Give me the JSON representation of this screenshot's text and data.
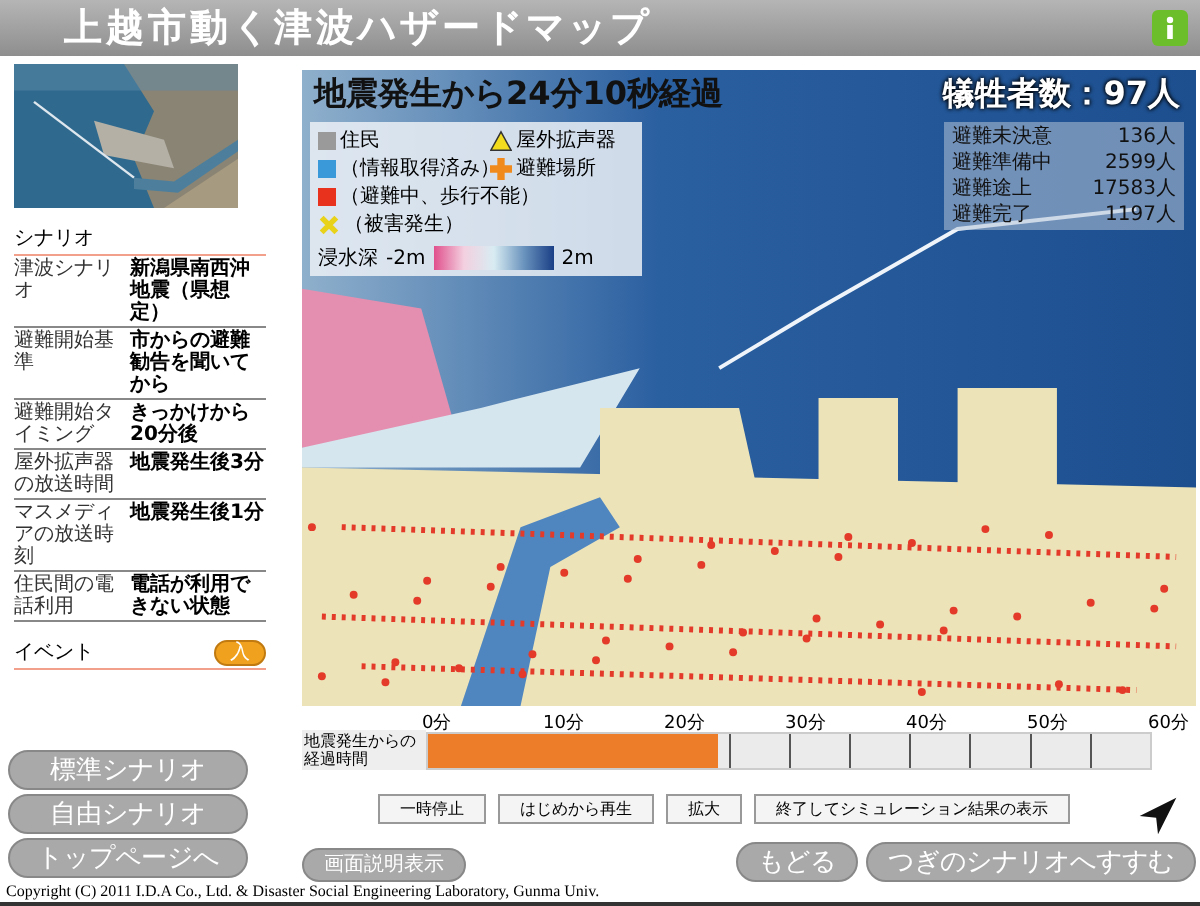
{
  "header": {
    "title": "上越市動く津波ハザードマップ"
  },
  "scenario": {
    "heading": "シナリオ",
    "rows": [
      {
        "label": "津波シナリオ",
        "value": "新潟県南西沖地震（県想定）"
      },
      {
        "label": "避難開始基準",
        "value": "市からの避難勧告を聞いてから"
      },
      {
        "label": "避難開始タイミング",
        "value": "きっかけから20分後"
      },
      {
        "label": "屋外拡声器の放送時間",
        "value": "地震発生後3分"
      },
      {
        "label": "マスメディアの放送時刻",
        "value": "地震発生後1分"
      },
      {
        "label": "住民間の電話利用",
        "value": "電話が利用できない状態"
      }
    ]
  },
  "event": {
    "heading": "イベント",
    "button": "入"
  },
  "map": {
    "elapsed": "地震発生から24分10秒経過",
    "casualties": "犠牲者数：97人",
    "legend": {
      "left_items": [
        {
          "kind": "square",
          "color": "#9a9a9a",
          "label": "住民"
        },
        {
          "kind": "square",
          "color": "#3a9ad9",
          "label": "（情報取得済み）"
        },
        {
          "kind": "square",
          "color": "#e8321e",
          "label": "（避難中、歩行不能）"
        },
        {
          "kind": "xmark",
          "label": "（被害発生）"
        }
      ],
      "right_items": [
        {
          "kind": "triangle",
          "label": "屋外拡声器"
        },
        {
          "kind": "cross",
          "label": "避難場所"
        }
      ],
      "scale": {
        "label": "浸水深",
        "min": "-2m",
        "max": "2m"
      }
    },
    "stats": [
      {
        "label": "避難未決意",
        "value": "136人"
      },
      {
        "label": "避難準備中",
        "value": "2599人"
      },
      {
        "label": "避難途上",
        "value": "17583人"
      },
      {
        "label": "避難完了",
        "value": "1197人"
      }
    ]
  },
  "timeline": {
    "label": "地震発生からの経過時間",
    "level": 0.403,
    "ticks": [
      "0分",
      "10分",
      "20分",
      "30分",
      "40分",
      "50分",
      "60分"
    ]
  },
  "controls": [
    "一時停止",
    "はじめから再生",
    "拡大",
    "終了してシミュレーション結果の表示"
  ],
  "side_buttons": [
    "標準シナリオ",
    "自由シナリオ",
    "トップページへ"
  ],
  "help_button": "画面説明表示",
  "nav_buttons": [
    "もどる",
    "つぎのシナリオへすすむ"
  ],
  "copyright": "Copyright (C) 2011 I.D.A Co., Ltd. & Disaster Social Engineering Laboratory, Gunma Univ."
}
